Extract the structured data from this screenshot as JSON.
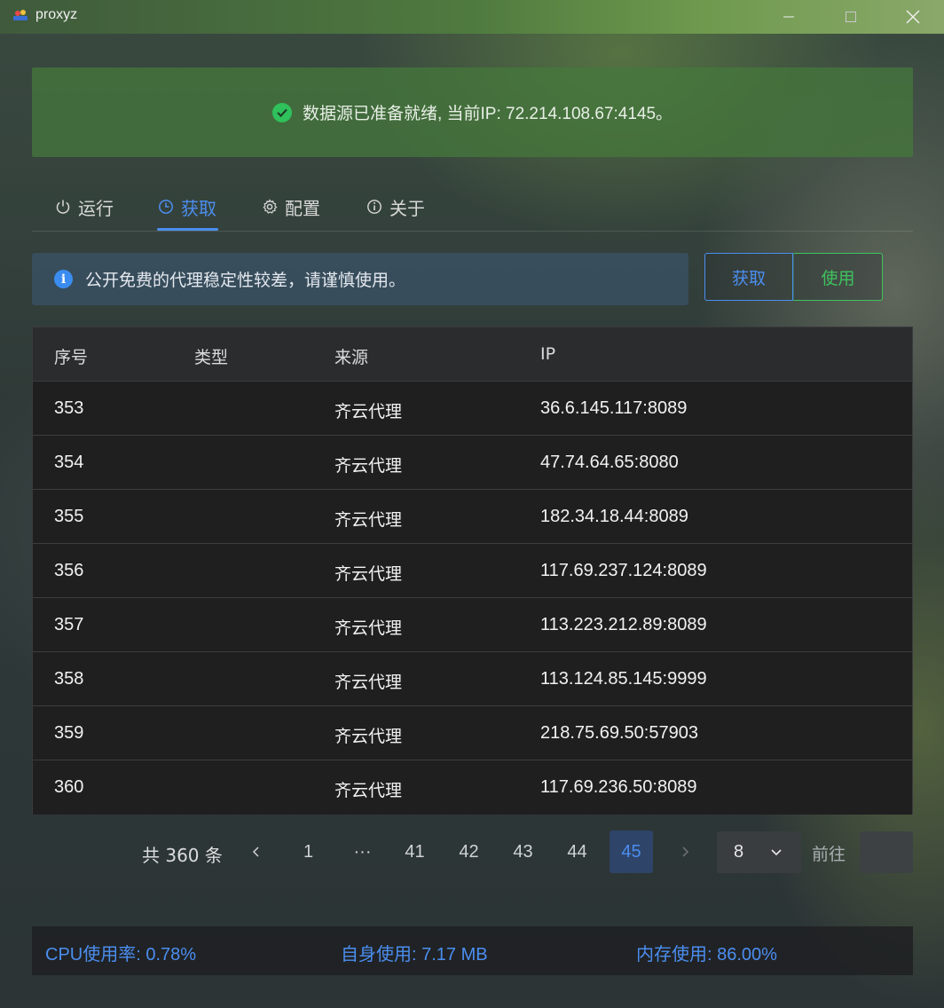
{
  "window": {
    "title": "proxyz",
    "icons": [
      "app-icon",
      "minimize-icon",
      "maximize-icon",
      "close-icon"
    ]
  },
  "banner": {
    "icon": "check-circle-icon",
    "text": "数据源已准备就绪, 当前IP: 72.214.108.67:4145。",
    "color": "#2fc15b"
  },
  "tabs": [
    {
      "label": "运行",
      "icon": "power-icon"
    },
    {
      "label": "获取",
      "icon": "clock-icon",
      "active": true
    },
    {
      "label": "配置",
      "icon": "gear-icon"
    },
    {
      "label": "关于",
      "icon": "info-icon"
    }
  ],
  "notice": {
    "icon": "info-circle-icon",
    "text": "公开免费的代理稳定性较差，请谨慎使用。"
  },
  "actions": {
    "fetch_label": "获取",
    "use_label": "使用"
  },
  "table": {
    "columns": [
      "序号",
      "类型",
      "来源",
      "IP"
    ],
    "rows": [
      {
        "id": "353",
        "type": "",
        "source": "齐云代理",
        "ip": "36.6.145.117:8089"
      },
      {
        "id": "354",
        "type": "",
        "source": "齐云代理",
        "ip": "47.74.64.65:8080"
      },
      {
        "id": "355",
        "type": "",
        "source": "齐云代理",
        "ip": "182.34.18.44:8089"
      },
      {
        "id": "356",
        "type": "",
        "source": "齐云代理",
        "ip": "117.69.237.124:8089"
      },
      {
        "id": "357",
        "type": "",
        "source": "齐云代理",
        "ip": "113.223.212.89:8089"
      },
      {
        "id": "358",
        "type": "",
        "source": "齐云代理",
        "ip": "113.124.85.145:9999"
      },
      {
        "id": "359",
        "type": "",
        "source": "齐云代理",
        "ip": "218.75.69.50:57903"
      },
      {
        "id": "360",
        "type": "",
        "source": "齐云代理",
        "ip": "117.69.236.50:8089"
      }
    ]
  },
  "pagination": {
    "total_text": "共 360 条",
    "pages": [
      "1",
      "···",
      "41",
      "42",
      "43",
      "44",
      "45"
    ],
    "current_page": "45",
    "page_size": "8",
    "goto_label": "前往",
    "goto_value": ""
  },
  "status": {
    "cpu": "CPU使用率: 0.78%",
    "self_mem": "自身使用: 7.17 MB",
    "mem": "内存使用: 86.00%"
  },
  "colors": {
    "accent": "#4b8ef0",
    "success": "#3ec35f"
  }
}
